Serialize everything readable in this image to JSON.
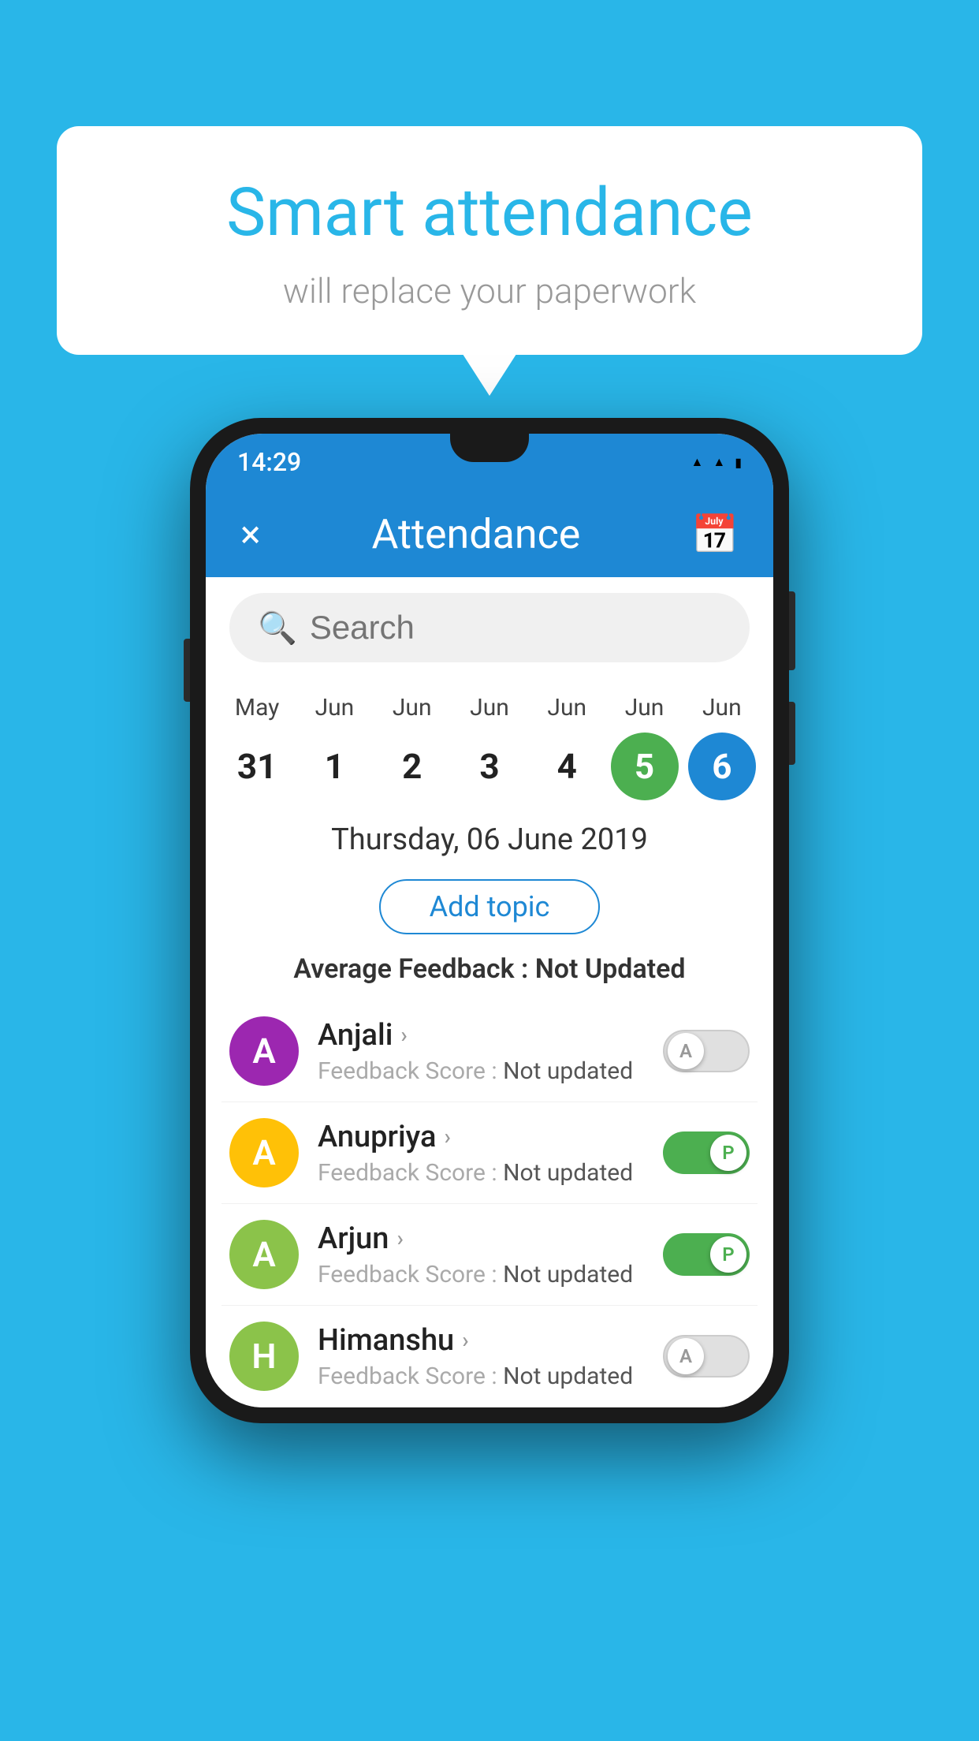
{
  "background_color": "#29b6e8",
  "speech_bubble": {
    "title": "Smart attendance",
    "subtitle": "will replace your paperwork"
  },
  "status_bar": {
    "time": "14:29",
    "icons": [
      "wifi",
      "signal",
      "battery"
    ]
  },
  "app_bar": {
    "title": "Attendance",
    "close_label": "×",
    "calendar_icon": "calendar"
  },
  "search": {
    "placeholder": "Search"
  },
  "calendar": {
    "items": [
      {
        "month": "May",
        "day": "31",
        "style": "normal"
      },
      {
        "month": "Jun",
        "day": "1",
        "style": "normal"
      },
      {
        "month": "Jun",
        "day": "2",
        "style": "normal"
      },
      {
        "month": "Jun",
        "day": "3",
        "style": "normal"
      },
      {
        "month": "Jun",
        "day": "4",
        "style": "normal"
      },
      {
        "month": "Jun",
        "day": "5",
        "style": "today"
      },
      {
        "month": "Jun",
        "day": "6",
        "style": "selected"
      }
    ]
  },
  "selected_date": "Thursday, 06 June 2019",
  "add_topic_label": "Add topic",
  "avg_feedback_label": "Average Feedback :",
  "avg_feedback_value": "Not Updated",
  "students": [
    {
      "name": "Anjali",
      "avatar_letter": "A",
      "avatar_color": "#9c27b0",
      "feedback_label": "Feedback Score :",
      "feedback_value": "Not updated",
      "toggle_state": "off",
      "toggle_letter": "A"
    },
    {
      "name": "Anupriya",
      "avatar_letter": "A",
      "avatar_color": "#ffc107",
      "feedback_label": "Feedback Score :",
      "feedback_value": "Not updated",
      "toggle_state": "on",
      "toggle_letter": "P"
    },
    {
      "name": "Arjun",
      "avatar_letter": "A",
      "avatar_color": "#8bc34a",
      "feedback_label": "Feedback Score :",
      "feedback_value": "Not updated",
      "toggle_state": "on",
      "toggle_letter": "P"
    },
    {
      "name": "Himanshu",
      "avatar_letter": "H",
      "avatar_color": "#8bc34a",
      "feedback_label": "Feedback Score :",
      "feedback_value": "Not updated",
      "toggle_state": "off",
      "toggle_letter": "A"
    }
  ]
}
